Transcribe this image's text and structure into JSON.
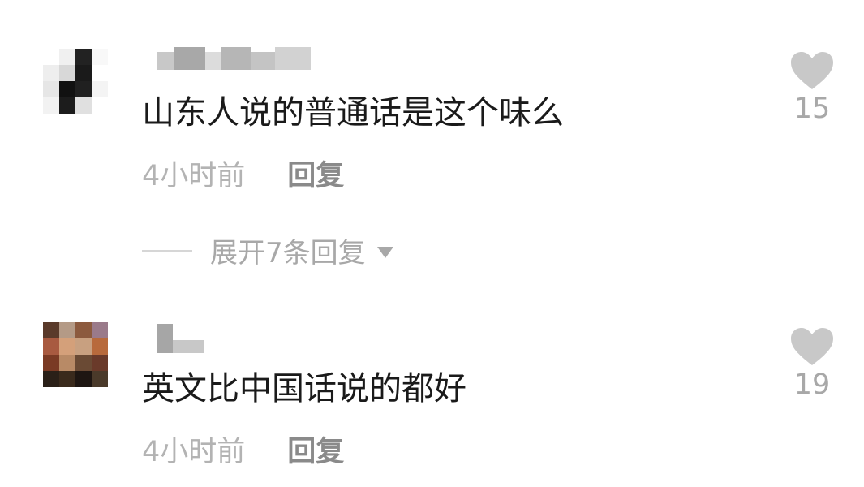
{
  "comments": [
    {
      "text": "山东人说的普通话是这个味么",
      "time": "4小时前",
      "reply_label": "回复",
      "likes": "15",
      "expand_label": "展开7条回复",
      "avatar_colors": [
        "#ffffff",
        "#f0f0f0",
        "#222222",
        "#f8f8f8",
        "#eeeeee",
        "#d8d8d8",
        "#1a1a1a",
        "#ffffff",
        "#e6e6e6",
        "#111111",
        "#202020",
        "#f4f4f4",
        "#f2f2f2",
        "#1c1c1c",
        "#e0e0e0",
        "#ffffff"
      ],
      "name_colors": [
        "#c8c8c8",
        "#a8a8a8",
        "#dcdcdc",
        "#b6b6b6",
        "#c4c4c4",
        "#d2d2d2"
      ]
    },
    {
      "text": "英文比中国话说的都好",
      "time": "4小时前",
      "reply_label": "回复",
      "likes": "19",
      "avatar_colors": [
        "#5a3a2a",
        "#b49a86",
        "#8c5a3e",
        "#9a7a8a",
        "#a85a40",
        "#d4a07a",
        "#c8a080",
        "#b86a3c",
        "#7a3a24",
        "#b88a66",
        "#6a4a34",
        "#6a3a2a",
        "#2a2018",
        "#3a2a1c",
        "#1e1612",
        "#4a3a2a"
      ],
      "name_colors": [
        "#a6a6a6",
        "#c8c8c8"
      ]
    }
  ],
  "colors": {
    "heart": "#c8c8c8",
    "text": "#1a1a1a",
    "muted": "#b3b3b3"
  },
  "icons": {
    "like": "heart-icon",
    "expand": "chevron-down-icon"
  }
}
